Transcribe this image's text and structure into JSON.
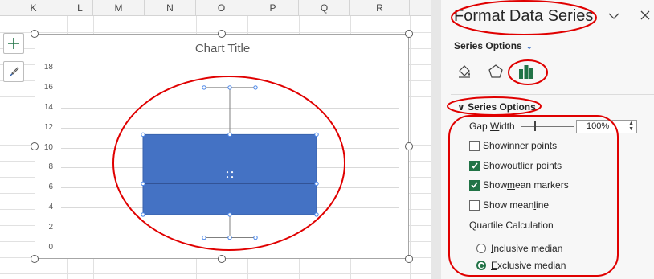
{
  "sheet": {
    "columns": [
      "K",
      "L",
      "M",
      "N",
      "O",
      "P",
      "Q",
      "R"
    ]
  },
  "chart": {
    "title": "Chart Title",
    "y_ticks": [
      "18",
      "16",
      "14",
      "12",
      "10",
      "8",
      "6",
      "4",
      "2",
      "0"
    ]
  },
  "chart_data": {
    "type": "box",
    "title": "Chart Title",
    "ylim": [
      0,
      18
    ],
    "y_tick_step": 2,
    "grid": true,
    "series": [
      {
        "whisker_min": 1,
        "q1": 3.3,
        "median": 6.4,
        "q3": 11.3,
        "whisker_max": 16
      }
    ]
  },
  "pane": {
    "title": "Format Data Series",
    "menu_label": "Series Options",
    "section_label": "Series Options",
    "gap_width_label_pre": "Gap ",
    "gap_width_label_ul": "W",
    "gap_width_label_post": "idth",
    "gap_width_value": "100%",
    "options": [
      {
        "pre": "Show ",
        "ul": "i",
        "post": "nner points",
        "checked": false
      },
      {
        "pre": "Show ",
        "ul": "o",
        "post": "utlier points",
        "checked": true
      },
      {
        "pre": "Show ",
        "ul": "m",
        "post": "ean markers",
        "checked": true
      },
      {
        "pre": "Show mean ",
        "ul": "l",
        "post": "ine",
        "checked": false
      }
    ],
    "quartile_label": "Quartile Calculation",
    "radios": [
      {
        "ul": "I",
        "post": "nclusive median",
        "checked": false
      },
      {
        "ul": "E",
        "post": "xclusive median",
        "checked": true
      }
    ]
  },
  "colors": {
    "box_fill": "#4472c4",
    "accent_green": "#217346",
    "annotation_red": "#e00000"
  },
  "icons": [
    "add-chart-element-icon",
    "chart-styles-icon",
    "fill-line-icon",
    "effects-icon",
    "series-options-icon",
    "chevron-down-icon",
    "close-icon"
  ]
}
